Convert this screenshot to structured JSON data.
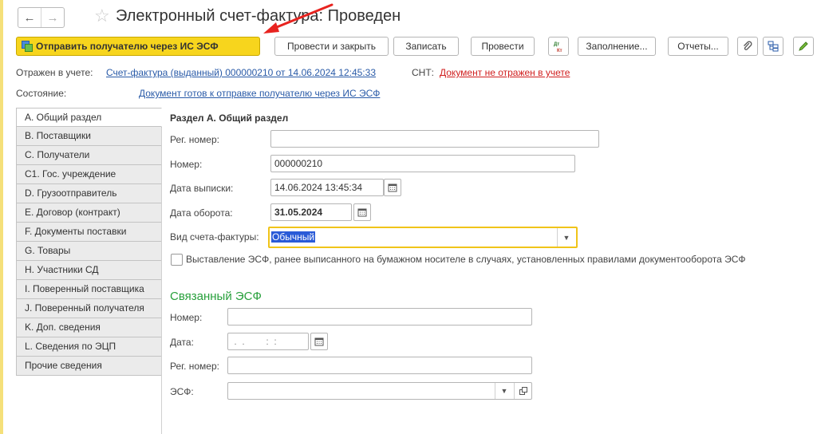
{
  "window": {
    "title": "Электронный счет-фактура: Проведен",
    "back_glyph": "←",
    "forward_glyph": "→",
    "star_glyph": "☆"
  },
  "toolbar": {
    "send_label": "Отправить получателю через ИС ЭСФ",
    "post_close_label": "Провести и закрыть",
    "write_label": "Записать",
    "post_label": "Провести",
    "fill_label": "Заполнение...",
    "reports_label": "Отчеты..."
  },
  "info": {
    "reflected_label": "Отражен в учете:",
    "reflected_link": "Счет-фактура (выданный) 000000210 от 14.06.2024 12:45:33",
    "snt_label": "СНТ:",
    "snt_link": "Документ не отражен в учете",
    "state_label": "Состояние:",
    "state_link": "Документ готов к отправке получателю через ИС ЭСФ"
  },
  "tabs": [
    "A. Общий раздел",
    "B. Поставщики",
    "C. Получатели",
    "C1. Гос. учреждение",
    "D. Грузоотправитель",
    "E. Договор (контракт)",
    "F. Документы поставки",
    "G. Товары",
    "H. Участники СД",
    "I. Поверенный поставщика",
    "J. Поверенный получателя",
    "K. Доп. сведения",
    "L. Сведения по ЭЦП",
    "Прочие сведения"
  ],
  "section_a": {
    "title": "Раздел А. Общий раздел",
    "reg_label": "Рег. номер:",
    "reg_value": "",
    "num_label": "Номер:",
    "num_value": "000000210",
    "date_label": "Дата выписки:",
    "date_value": "14.06.2024 13:45:34",
    "turnover_label": "Дата оборота:",
    "turnover_value": "31.05.2024",
    "kind_label": "Вид счета-фактуры:",
    "kind_value": "Обычный",
    "paper_checkbox_label": "Выставление ЭСФ, ранее выписанного на бумажном носителе в случаях, установленных правилами документооборота ЭСФ"
  },
  "linked": {
    "title": "Связанный ЭСФ",
    "num_label": "Номер:",
    "num_value": "",
    "date_label": "Дата:",
    "date_mask": " .  .        :  :",
    "reg_label": "Рег. номер:",
    "reg_value": "",
    "esf_label": "ЭСФ:",
    "esf_value": ""
  },
  "colors": {
    "primary_button": "#f7d51d",
    "link": "#2a5ba8",
    "error_link": "#d01f1f",
    "section_green": "#28a03c",
    "focus_border": "#f0c419",
    "annotation_arrow": "#e8231f"
  },
  "icons": [
    "back-arrow-icon",
    "forward-arrow-icon",
    "favorite-star-icon",
    "send-esf-icon",
    "dt-kt-icon",
    "paperclip-icon",
    "structure-icon",
    "edit-pencil-icon",
    "calendar-icon",
    "dropdown-icon",
    "open-form-icon"
  ]
}
